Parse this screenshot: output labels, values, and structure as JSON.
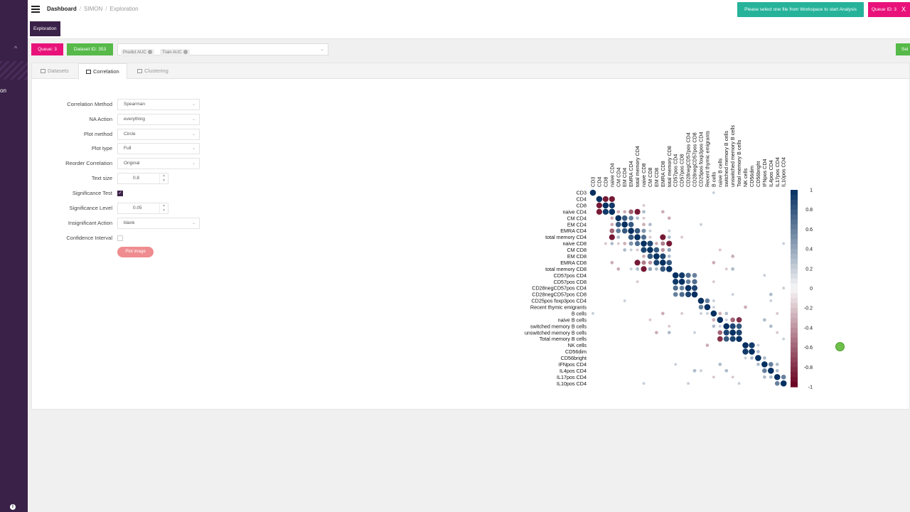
{
  "sidebar": {
    "partial_label": "on"
  },
  "header": {
    "breadcrumbs": [
      "Dashboard",
      "SIMON",
      "Exploration"
    ],
    "notice": "Please select one file from Workspace to start Analysis",
    "queue_id": "Queue ID: 3",
    "close": "X"
  },
  "band": {
    "title": "Exploration"
  },
  "actions": {
    "queue": "Queue: 3",
    "dataset": "Dataset ID: 353",
    "tags": [
      "Predict AUC",
      "Train AUC"
    ],
    "select_partial": "Sel"
  },
  "tabs": [
    "Datasets",
    "Correlation",
    "Clustering"
  ],
  "form": {
    "correlation_method": {
      "label": "Correlation Method",
      "value": "Spearman"
    },
    "na_action": {
      "label": "NA Action",
      "value": "everything"
    },
    "plot_method": {
      "label": "Plot method",
      "value": "Circle"
    },
    "plot_type": {
      "label": "Plot type",
      "value": "Full"
    },
    "reorder": {
      "label": "Reorder Correlation",
      "value": "Original"
    },
    "text_size": {
      "label": "Text size",
      "value": "0.8"
    },
    "significance_test": {
      "label": "Significance Test",
      "checked": true
    },
    "significance_level": {
      "label": "Significance Level",
      "value": "0.05"
    },
    "insignificant_action": {
      "label": "Insignificant Action",
      "value": "blank"
    },
    "confidence_interval": {
      "label": "Confidence Interval",
      "checked": false
    },
    "plot_button": "Plot image"
  },
  "chart_data": {
    "type": "heatmap",
    "variables": [
      "CD3",
      "CD4",
      "CD8",
      "naive CD4",
      "CM CD4",
      "EM CD4",
      "EMRA CD4",
      "total memory CD4",
      "naive CD8",
      "CM CD8",
      "EM CD8",
      "EMRA CD8",
      "total memory CD8",
      "CD57pos CD4",
      "CD57pos CD8",
      "CD28negCD57pos CD4",
      "CD28negCD57pos CD8",
      "CD25pos foxp3pos CD4",
      "Recent thymic emigrants",
      "B cells",
      "naive B cells",
      "switched memory B cells",
      "unswitched memory B cells",
      "Total memory B cells",
      "NK cells",
      "CD56dim",
      "CD56bright",
      "IFNpos CD4",
      "IL4pos CD4",
      "IL17pos CD4",
      "IL10pos CD4"
    ],
    "colorbar_ticks": [
      "1",
      "0.8",
      "0.6",
      "0.4",
      "0.2",
      "0",
      "-0.2",
      "-0.4",
      "-0.6",
      "-0.8",
      "-1"
    ],
    "colorbar_range": [
      -1,
      1
    ],
    "colors": {
      "positive": "#053061",
      "zero": "#f7f7f7",
      "negative": "#67001f"
    },
    "cells": [
      [
        1,
        2,
        -0.9
      ],
      [
        1,
        3,
        -0.9
      ],
      [
        2,
        3,
        0.95
      ],
      [
        3,
        4,
        -0.3
      ],
      [
        3,
        5,
        -0.3
      ],
      [
        3,
        6,
        -0.6
      ],
      [
        3,
        7,
        -0.9
      ],
      [
        3,
        8,
        0.3
      ],
      [
        3,
        11,
        -0.3
      ],
      [
        4,
        5,
        0.8
      ],
      [
        4,
        6,
        0.6
      ],
      [
        4,
        7,
        0.3
      ],
      [
        4,
        8,
        -0.2
      ],
      [
        5,
        6,
        0.8
      ],
      [
        5,
        8,
        -0.3
      ],
      [
        5,
        9,
        0.3
      ],
      [
        6,
        7,
        0.8
      ],
      [
        6,
        8,
        0.5
      ],
      [
        6,
        9,
        0.2
      ],
      [
        7,
        8,
        0.7
      ],
      [
        7,
        9,
        -0.2
      ],
      [
        7,
        11,
        -0.9
      ],
      [
        7,
        12,
        0.3
      ],
      [
        8,
        9,
        0.9
      ],
      [
        8,
        10,
        -0.3
      ],
      [
        8,
        11,
        -0.5
      ],
      [
        8,
        12,
        -0.9
      ],
      [
        9,
        10,
        0.8
      ],
      [
        9,
        11,
        -0.4
      ],
      [
        9,
        12,
        0.4
      ],
      [
        10,
        11,
        0.9
      ],
      [
        10,
        12,
        0.3
      ],
      [
        11,
        12,
        0.8
      ],
      [
        13,
        14,
        0.95
      ],
      [
        13,
        15,
        0.7
      ],
      [
        13,
        16,
        0.6
      ],
      [
        14,
        15,
        0.6
      ],
      [
        14,
        16,
        0.7
      ],
      [
        15,
        16,
        0.9
      ],
      [
        17,
        18,
        0.6
      ],
      [
        17,
        19,
        0.2
      ],
      [
        18,
        19,
        0.2
      ],
      [
        19,
        20,
        -0.3
      ],
      [
        19,
        21,
        0.3
      ],
      [
        20,
        21,
        0.2
      ],
      [
        20,
        22,
        -0.6
      ],
      [
        20,
        23,
        -0.8
      ],
      [
        21,
        22,
        0.9
      ],
      [
        21,
        23,
        0.8
      ],
      [
        22,
        23,
        0.9
      ],
      [
        24,
        25,
        0.95
      ],
      [
        24,
        26,
        0.2
      ],
      [
        25,
        26,
        0.3
      ],
      [
        26,
        27,
        0.3
      ],
      [
        27,
        28,
        0.6
      ],
      [
        27,
        29,
        0.3
      ],
      [
        28,
        29,
        0.3
      ],
      [
        29,
        30,
        0.6
      ],
      [
        0,
        19,
        0.2
      ],
      [
        2,
        8,
        -0.2
      ],
      [
        4,
        12,
        -0.3
      ],
      [
        6,
        12,
        0.2
      ],
      [
        9,
        20,
        -0.2
      ],
      [
        12,
        21,
        -0.2
      ],
      [
        12,
        22,
        0.3
      ],
      [
        14,
        19,
        -0.2
      ],
      [
        16,
        22,
        0.2
      ],
      [
        16,
        28,
        0.3
      ],
      [
        18,
        24,
        -0.3
      ],
      [
        5,
        17,
        0.2
      ],
      [
        7,
        14,
        -0.2
      ],
      [
        8,
        30,
        0.2
      ],
      [
        10,
        22,
        -0.3
      ],
      [
        13,
        27,
        0.2
      ],
      [
        15,
        30,
        0.2
      ],
      [
        20,
        27,
        0.3
      ],
      [
        22,
        29,
        -0.2
      ],
      [
        23,
        30,
        0.2
      ],
      [
        11,
        19,
        -0.3
      ],
      [
        17,
        28,
        0.2
      ],
      [
        19,
        29,
        -0.2
      ],
      [
        21,
        28,
        0.3
      ]
    ]
  }
}
